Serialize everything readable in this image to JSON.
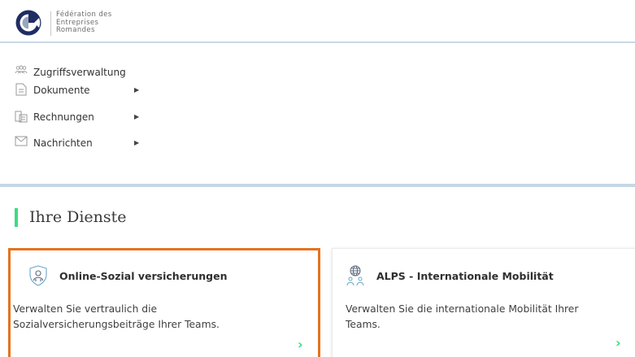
{
  "header": {
    "org_name": "Fédération des\nEntreprises\nRomandes",
    "logo_icon": "fer-logo-icon"
  },
  "nav": {
    "items": [
      {
        "label": "Zugriffsverwaltung",
        "icon": "users-icon",
        "has_submenu": false
      },
      {
        "label": "Dokumente",
        "icon": "document-icon",
        "has_submenu": true
      },
      {
        "label": "Rechnungen",
        "icon": "invoices-icon",
        "has_submenu": true
      },
      {
        "label": "Nachrichten",
        "icon": "envelope-icon",
        "has_submenu": true
      }
    ]
  },
  "services": {
    "title": "Ihre Dienste",
    "cards": [
      {
        "title": "Online-Sozial versicherungen",
        "description": "Verwalten Sie vertraulich die Sozialversicherungsbeiträge Ihrer Teams.",
        "icon": "shield-person-icon",
        "selected": true
      },
      {
        "title": "ALPS - Internationale Mobilität",
        "description": "Verwalten Sie die internationale Mobilität Ihrer Teams.",
        "icon": "globe-people-icon",
        "selected": false
      }
    ]
  },
  "colors": {
    "accent_green": "#3bdc82",
    "selected_border": "#e3731e",
    "divider_blue": "#c5d7e6",
    "logo_navy": "#1f2d63"
  }
}
